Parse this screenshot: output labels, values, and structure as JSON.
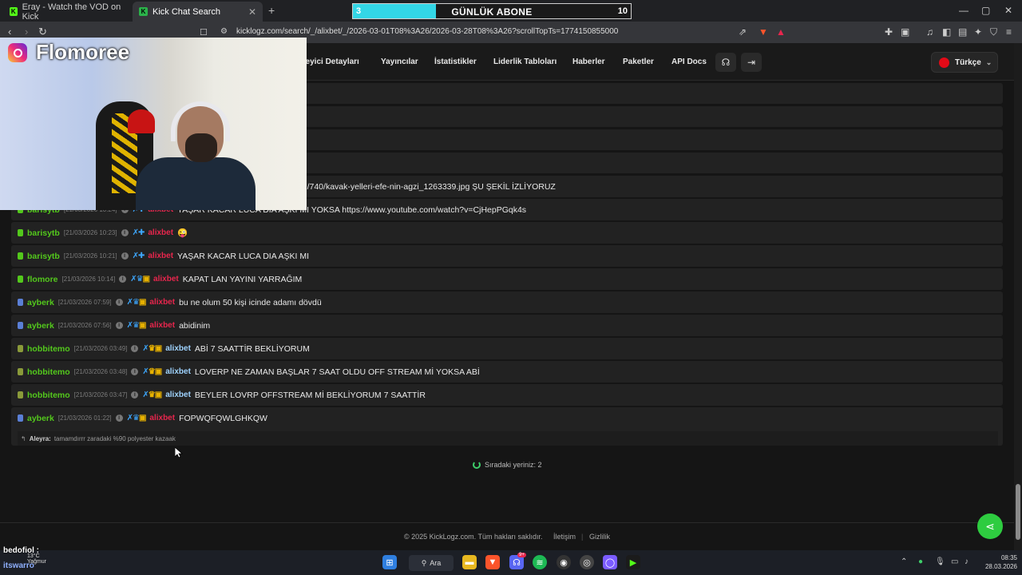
{
  "browser": {
    "tabs": [
      {
        "title": "Eray - Watch the VOD on Kick"
      },
      {
        "title": "Kick Chat Search"
      }
    ],
    "new_tab": "+",
    "url": "kicklogz.com/search/_/alixbet/_/2026-03-01T08%3A26/2026-03-28T08%3A26?scrollTopTs=1774150855000"
  },
  "sub_goal": {
    "current": "3",
    "title": "GÜNLÜK ABONE",
    "goal": "10",
    "progress": 0.3
  },
  "nav": {
    "links": [
      "İzleyici Detayları",
      "Yayıncılar",
      "İstatistikler",
      "Liderlik Tabloları",
      "Haberler",
      "Paketler",
      "API Docs"
    ],
    "language": "Türkçe"
  },
  "webcam": {
    "name": "Flomoree"
  },
  "messages": [
    {
      "user": "barisytb",
      "ts": "[21/03/2026 10:24]",
      "channel": "alixbet",
      "text": "YAŞAR KACAR LUCA DIA AŞKI MI YOKSA https://www.youtube.com/watch?v=CjHepPGqk4s",
      "chan_color": "red"
    },
    {
      "user": "barisytb",
      "ts": "[21/03/2026 10:23]",
      "channel": "alixbet",
      "text": "😜",
      "chan_color": "red"
    },
    {
      "user": "barisytb",
      "ts": "[21/03/2026 10:21]",
      "channel": "alixbet",
      "text": "YAŞAR KACAR LUCA DIA AŞKI MI",
      "chan_color": "red"
    },
    {
      "user": "flomore",
      "ts": "[21/03/2026 10:14]",
      "channel": "alixbet",
      "text": "KAPAT LAN YAYINI YARRAĞIM",
      "chan_color": "red"
    },
    {
      "user": "ayberk",
      "ts": "[21/03/2026 07:59]",
      "channel": "alixbet",
      "text": "bu ne olum 50 kişi icinde adamı dövdü",
      "chan_color": "red"
    },
    {
      "user": "ayberk",
      "ts": "[21/03/2026 07:56]",
      "channel": "alixbet",
      "text": "abidinim",
      "chan_color": "red"
    },
    {
      "user": "hobbitemo",
      "ts": "[21/03/2026 03:49]",
      "channel": "alixbet",
      "text": "ABİ 7 SAATTİR BEKLİYORUM",
      "chan_color": "blue"
    },
    {
      "user": "hobbitemo",
      "ts": "[21/03/2026 03:48]",
      "channel": "alixbet",
      "text": "LOVERP NE ZAMAN BAŞLAR 7 SAAT OLDU OFF STREAM Mİ YOKSA ABİ",
      "chan_color": "blue"
    },
    {
      "user": "hobbitemo",
      "ts": "[21/03/2026 03:47]",
      "channel": "alixbet",
      "text": "BEYLER LOVRP OFFSTREAM Mİ BEKLİYORUM 7 SAATTİR",
      "chan_color": "blue"
    },
    {
      "user": "ayberk",
      "ts": "[21/03/2026 01:22]",
      "channel": "alixbet",
      "text": "FOPWQFQWLGHKQW",
      "chan_color": "red"
    }
  ],
  "partial_message": "om/740/kavak-yelleri-efe-nin-agzi_1263339.jpg ŞU ŞEKİL İZLİYORUZ",
  "reply": {
    "author": "Aleyra:",
    "text": "tamamdırrr zaradaki %90 polyester kazaak"
  },
  "queue": "Sıradaki yeriniz: 2",
  "footer": {
    "copyright": "© 2025 KickLogz.com. Tüm hakları saklıdır.",
    "contact": "İletişim",
    "separator": "|",
    "privacy": "Gizlilik"
  },
  "overlay": {
    "user": "bedofiol :",
    "user2": "itswarro",
    "weather_temp": "13°C",
    "weather_text": "Yağmur"
  },
  "taskbar": {
    "search": "Ara",
    "time": "08:35",
    "date": "28.03.2026",
    "badge": "9+"
  }
}
